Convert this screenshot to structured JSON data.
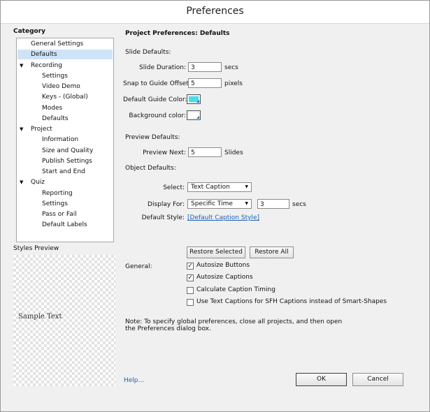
{
  "window": {
    "title": "Preferences"
  },
  "category_label": "Category",
  "tree": [
    {
      "label": "General Settings",
      "level": 1,
      "selected": false,
      "expander": ""
    },
    {
      "label": "Defaults",
      "level": 1,
      "selected": true,
      "expander": ""
    },
    {
      "label": "Recording",
      "level": 1,
      "selected": false,
      "expander": "▼"
    },
    {
      "label": "Settings",
      "level": 2,
      "selected": false,
      "expander": ""
    },
    {
      "label": "Video Demo",
      "level": 2,
      "selected": false,
      "expander": ""
    },
    {
      "label": "Keys - (Global)",
      "level": 2,
      "selected": false,
      "expander": ""
    },
    {
      "label": "Modes",
      "level": 2,
      "selected": false,
      "expander": ""
    },
    {
      "label": "Defaults",
      "level": 2,
      "selected": false,
      "expander": ""
    },
    {
      "label": "Project",
      "level": 1,
      "selected": false,
      "expander": "▼"
    },
    {
      "label": "Information",
      "level": 2,
      "selected": false,
      "expander": ""
    },
    {
      "label": "Size and Quality",
      "level": 2,
      "selected": false,
      "expander": ""
    },
    {
      "label": "Publish Settings",
      "level": 2,
      "selected": false,
      "expander": ""
    },
    {
      "label": "Start and End",
      "level": 2,
      "selected": false,
      "expander": ""
    },
    {
      "label": "Quiz",
      "level": 1,
      "selected": false,
      "expander": "▼"
    },
    {
      "label": "Reporting",
      "level": 2,
      "selected": false,
      "expander": ""
    },
    {
      "label": "Settings",
      "level": 2,
      "selected": false,
      "expander": ""
    },
    {
      "label": "Pass or Fail",
      "level": 2,
      "selected": false,
      "expander": ""
    },
    {
      "label": "Default Labels",
      "level": 2,
      "selected": false,
      "expander": ""
    }
  ],
  "styles_preview": {
    "label": "Styles Preview",
    "sample_text": "Sample Text"
  },
  "panel": {
    "heading": "Project Preferences: Defaults",
    "slide_defaults": {
      "label": "Slide Defaults:",
      "duration_label": "Slide Duration:",
      "duration_value": "3",
      "duration_unit": "secs",
      "snap_label": "Snap to Guide Offset:",
      "snap_value": "5",
      "snap_unit": "pixels",
      "guide_color_label": "Default Guide Color:",
      "guide_color": "#3ee0ee",
      "bg_color_label": "Background color:",
      "bg_color": "#ffffff"
    },
    "preview_defaults": {
      "label": "Preview Defaults:",
      "next_label": "Preview Next:",
      "next_value": "5",
      "next_unit": "Slides"
    },
    "object_defaults": {
      "label": "Object Defaults:",
      "select_label": "Select:",
      "select_value": "Text Caption",
      "display_label": "Display For:",
      "display_value": "Specific Time",
      "display_secs_value": "3",
      "display_secs_unit": "secs",
      "style_label": "Default Style:",
      "style_link": "[Default Caption Style]"
    },
    "restore_selected": "Restore Selected",
    "restore_all": "Restore All",
    "general": {
      "label": "General:",
      "options": [
        {
          "label": "Autosize Buttons",
          "checked": true
        },
        {
          "label": "Autosize Captions",
          "checked": true
        },
        {
          "label": "Calculate Caption Timing",
          "checked": false
        },
        {
          "label": "Use Text Captions for SFH Captions instead of Smart-Shapes",
          "checked": false
        }
      ]
    },
    "note_line1": "Note: To specify global preferences, close all projects, and then open",
    "note_line2": "the Preferences dialog box."
  },
  "footer": {
    "help": "Help...",
    "ok": "OK",
    "cancel": "Cancel"
  }
}
